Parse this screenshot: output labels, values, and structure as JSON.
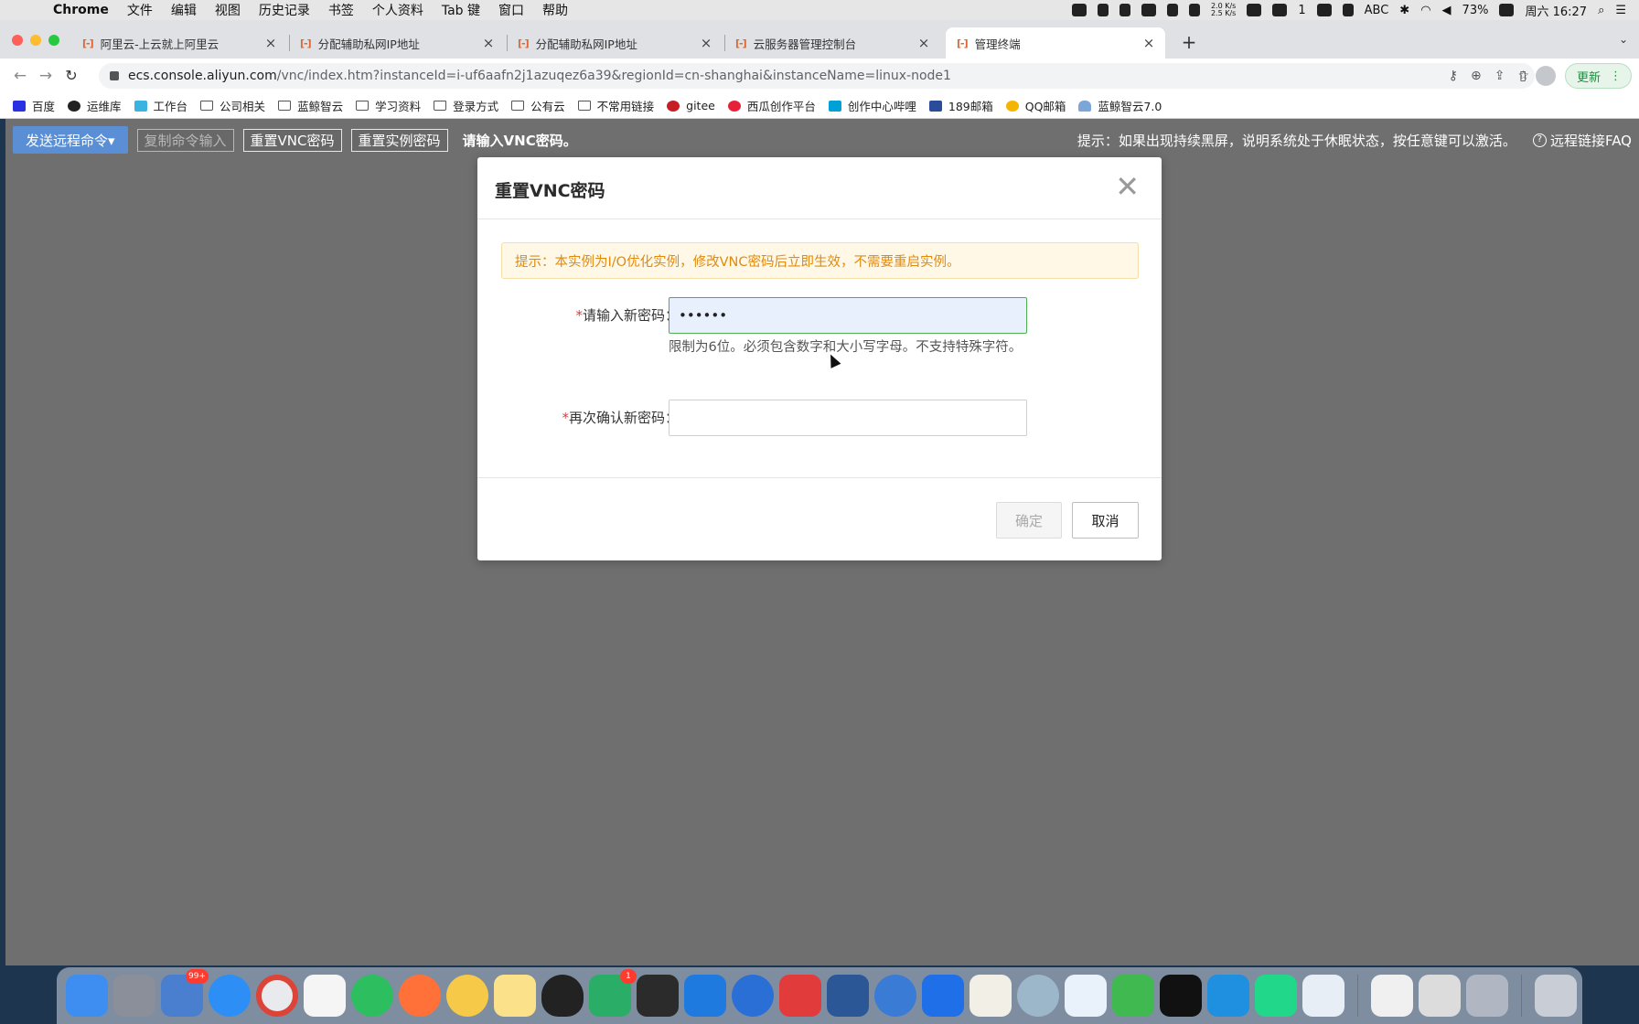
{
  "menubar": {
    "app": "Chrome",
    "items": [
      "文件",
      "编辑",
      "视图",
      "历史记录",
      "书签",
      "个人资料",
      "Tab 键",
      "窗口",
      "帮助"
    ],
    "net_up": "2.0 K/s",
    "net_down": "2.5 K/s",
    "wechat_count": "1",
    "input_method": "ABC",
    "battery": "73%",
    "clock": "周六 16:27"
  },
  "tabs": [
    {
      "label": "阿里云-上云就上阿里云",
      "active": false
    },
    {
      "label": "分配辅助私网IP地址",
      "active": false
    },
    {
      "label": "分配辅助私网IP地址",
      "active": false
    },
    {
      "label": "云服务器管理控制台",
      "active": false
    },
    {
      "label": "管理终端",
      "active": true
    }
  ],
  "tab_favicon": "[-]",
  "tab_close": "×",
  "new_tab": "+",
  "address": {
    "host": "ecs.console.aliyun.com",
    "path": "/vnc/index.htm?instanceId=i-uf6aafn2j1azuqez6a39&regionId=cn-shanghai&instanceName=linux-node1",
    "update_label": "更新"
  },
  "bookmarks": [
    {
      "label": "百度",
      "icon": "baidu-paw-icon"
    },
    {
      "label": "运维库",
      "icon": "github-icon"
    },
    {
      "label": "工作台",
      "icon": "workbench-icon"
    },
    {
      "label": "公司相关",
      "icon": "folder-icon"
    },
    {
      "label": "蓝鲸智云",
      "icon": "folder-icon"
    },
    {
      "label": "学习资料",
      "icon": "folder-icon"
    },
    {
      "label": "登录方式",
      "icon": "folder-icon"
    },
    {
      "label": "公有云",
      "icon": "folder-icon"
    },
    {
      "label": "不常用链接",
      "icon": "folder-icon"
    },
    {
      "label": "gitee",
      "icon": "gitee-icon"
    },
    {
      "label": "西瓜创作平台",
      "icon": "xigua-icon"
    },
    {
      "label": "创作中心哔哩",
      "icon": "bilibili-icon"
    },
    {
      "label": "189邮箱",
      "icon": "mail189-icon"
    },
    {
      "label": "QQ邮箱",
      "icon": "qqmail-icon"
    },
    {
      "label": "蓝鲸智云7.0",
      "icon": "cloud-icon"
    }
  ],
  "vnc_toolbar": {
    "send_cmd": "发送远程命令▾",
    "copy_input": "复制命令输入",
    "reset_vnc": "重置VNC密码",
    "reset_instance": "重置实例密码",
    "status": "请输入VNC密码。",
    "hint": "提示：如果出现持续黑屏，说明系统处于休眠状态，按任意键可以激活。",
    "faq": "远程链接FAQ"
  },
  "modal": {
    "title": "重置VNC密码",
    "close": "✕",
    "notice": "提示：本实例为I/O优化实例，修改VNC密码后立即生效，不需要重启实例。",
    "required_mark": "*",
    "pwd_label": "请输入新密码：",
    "pwd_value": "••••••",
    "pwd_help": "限制为6位。必须包含数字和大小写字母。不支持特殊字符。",
    "confirm_label": "再次确认新密码：",
    "confirm_value": "",
    "ok": "确定",
    "cancel": "取消"
  },
  "dock": {
    "badges": {
      "mail": "99+",
      "wechat": "1"
    },
    "apps": [
      "finder-icon",
      "launchpad-icon",
      "mail-icon",
      "safari-icon",
      "chrome-icon",
      "typora-icon",
      "evernote-icon",
      "firefox-icon",
      "photos-icon",
      "notes-icon",
      "qq-icon",
      "wechat-icon",
      "terminal-app-icon",
      "lark-icon",
      "remote-desktop-icon",
      "wps-icon",
      "word-icon",
      "k-icon",
      "feishu-icon",
      "textedit-icon",
      "snail-icon",
      "baidu-netdisk-icon",
      "infuse-icon",
      "iterm-icon",
      "vscode-icon",
      "pycharm-icon",
      "quicktime-icon",
      "preview-icon",
      "script-editor-icon",
      "screenshot-icon",
      "trash-icon"
    ]
  },
  "colors": {
    "vnc_bg": "#6f6f6f",
    "primary_btn": "#5a8fd6",
    "notice_text": "#e08a10",
    "notice_bg": "#fff8e6",
    "input_focus": "#4caf50",
    "required": "#e53935"
  }
}
